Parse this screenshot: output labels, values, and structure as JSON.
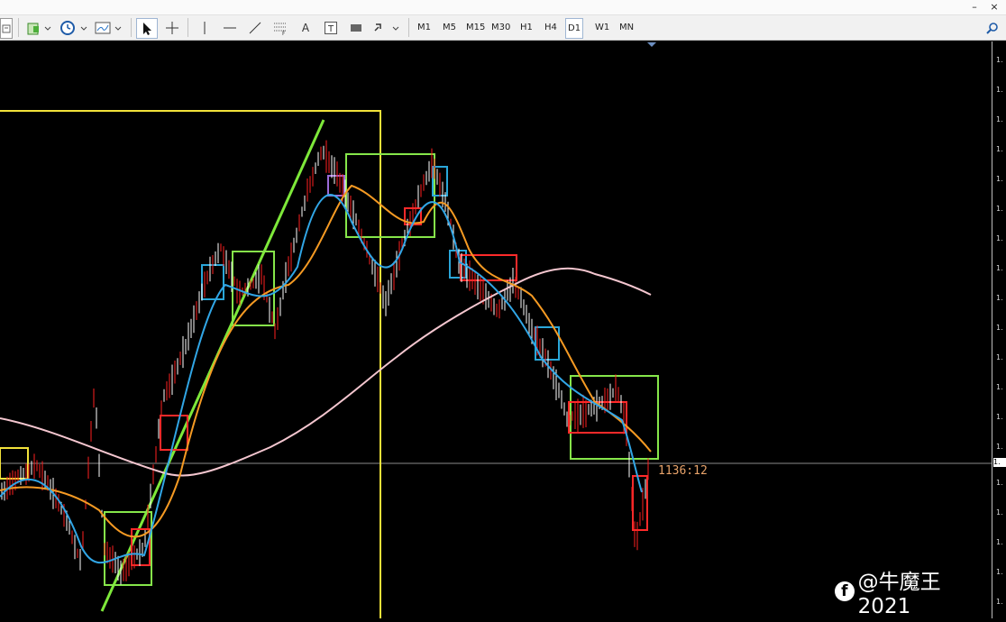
{
  "window": {
    "minimize_label": "–",
    "close_label": "×"
  },
  "toolbar": {
    "timeframes": [
      "M1",
      "M5",
      "M15",
      "M30",
      "H1",
      "H4",
      "D1",
      "W1",
      "MN"
    ],
    "active_timeframe": "D1",
    "line_tool_letter": "A",
    "text_label_letter": "T"
  },
  "chart": {
    "countdown": "1136:12",
    "current_price_label": "1.",
    "price_axis_tick": "1.",
    "background": "#000000",
    "bull_color": "#ffffff",
    "bear_color": "#ff2020"
  },
  "watermark": {
    "text": "@牛魔王2021",
    "icon": "facebook-icon"
  },
  "icons": {
    "new_chart": "new-chart-icon",
    "history": "clock-icon",
    "templates": "templates-icon",
    "cursor": "cursor-arrow-icon",
    "crosshair": "crosshair-icon",
    "vertical_line": "vertical-line-icon",
    "horizontal_line": "horizontal-line-icon",
    "trendline": "trendline-icon",
    "fibonacci": "fibonacci-icon",
    "rectangle": "rectangle-icon",
    "arrows": "arrows-icon",
    "search": "search-icon"
  }
}
